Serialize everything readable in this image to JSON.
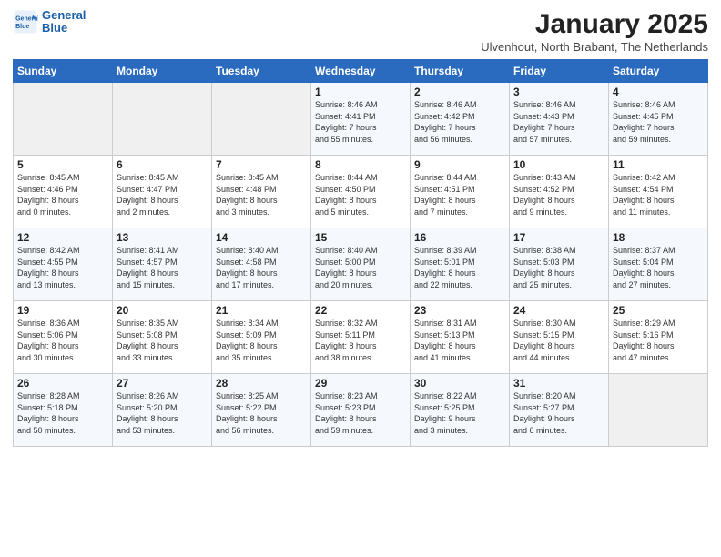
{
  "header": {
    "logo_line1": "General",
    "logo_line2": "Blue",
    "title": "January 2025",
    "subtitle": "Ulvenhout, North Brabant, The Netherlands"
  },
  "weekdays": [
    "Sunday",
    "Monday",
    "Tuesday",
    "Wednesday",
    "Thursday",
    "Friday",
    "Saturday"
  ],
  "weeks": [
    [
      {
        "day": "",
        "info": ""
      },
      {
        "day": "",
        "info": ""
      },
      {
        "day": "",
        "info": ""
      },
      {
        "day": "1",
        "info": "Sunrise: 8:46 AM\nSunset: 4:41 PM\nDaylight: 7 hours\nand 55 minutes."
      },
      {
        "day": "2",
        "info": "Sunrise: 8:46 AM\nSunset: 4:42 PM\nDaylight: 7 hours\nand 56 minutes."
      },
      {
        "day": "3",
        "info": "Sunrise: 8:46 AM\nSunset: 4:43 PM\nDaylight: 7 hours\nand 57 minutes."
      },
      {
        "day": "4",
        "info": "Sunrise: 8:46 AM\nSunset: 4:45 PM\nDaylight: 7 hours\nand 59 minutes."
      }
    ],
    [
      {
        "day": "5",
        "info": "Sunrise: 8:45 AM\nSunset: 4:46 PM\nDaylight: 8 hours\nand 0 minutes."
      },
      {
        "day": "6",
        "info": "Sunrise: 8:45 AM\nSunset: 4:47 PM\nDaylight: 8 hours\nand 2 minutes."
      },
      {
        "day": "7",
        "info": "Sunrise: 8:45 AM\nSunset: 4:48 PM\nDaylight: 8 hours\nand 3 minutes."
      },
      {
        "day": "8",
        "info": "Sunrise: 8:44 AM\nSunset: 4:50 PM\nDaylight: 8 hours\nand 5 minutes."
      },
      {
        "day": "9",
        "info": "Sunrise: 8:44 AM\nSunset: 4:51 PM\nDaylight: 8 hours\nand 7 minutes."
      },
      {
        "day": "10",
        "info": "Sunrise: 8:43 AM\nSunset: 4:52 PM\nDaylight: 8 hours\nand 9 minutes."
      },
      {
        "day": "11",
        "info": "Sunrise: 8:42 AM\nSunset: 4:54 PM\nDaylight: 8 hours\nand 11 minutes."
      }
    ],
    [
      {
        "day": "12",
        "info": "Sunrise: 8:42 AM\nSunset: 4:55 PM\nDaylight: 8 hours\nand 13 minutes."
      },
      {
        "day": "13",
        "info": "Sunrise: 8:41 AM\nSunset: 4:57 PM\nDaylight: 8 hours\nand 15 minutes."
      },
      {
        "day": "14",
        "info": "Sunrise: 8:40 AM\nSunset: 4:58 PM\nDaylight: 8 hours\nand 17 minutes."
      },
      {
        "day": "15",
        "info": "Sunrise: 8:40 AM\nSunset: 5:00 PM\nDaylight: 8 hours\nand 20 minutes."
      },
      {
        "day": "16",
        "info": "Sunrise: 8:39 AM\nSunset: 5:01 PM\nDaylight: 8 hours\nand 22 minutes."
      },
      {
        "day": "17",
        "info": "Sunrise: 8:38 AM\nSunset: 5:03 PM\nDaylight: 8 hours\nand 25 minutes."
      },
      {
        "day": "18",
        "info": "Sunrise: 8:37 AM\nSunset: 5:04 PM\nDaylight: 8 hours\nand 27 minutes."
      }
    ],
    [
      {
        "day": "19",
        "info": "Sunrise: 8:36 AM\nSunset: 5:06 PM\nDaylight: 8 hours\nand 30 minutes."
      },
      {
        "day": "20",
        "info": "Sunrise: 8:35 AM\nSunset: 5:08 PM\nDaylight: 8 hours\nand 33 minutes."
      },
      {
        "day": "21",
        "info": "Sunrise: 8:34 AM\nSunset: 5:09 PM\nDaylight: 8 hours\nand 35 minutes."
      },
      {
        "day": "22",
        "info": "Sunrise: 8:32 AM\nSunset: 5:11 PM\nDaylight: 8 hours\nand 38 minutes."
      },
      {
        "day": "23",
        "info": "Sunrise: 8:31 AM\nSunset: 5:13 PM\nDaylight: 8 hours\nand 41 minutes."
      },
      {
        "day": "24",
        "info": "Sunrise: 8:30 AM\nSunset: 5:15 PM\nDaylight: 8 hours\nand 44 minutes."
      },
      {
        "day": "25",
        "info": "Sunrise: 8:29 AM\nSunset: 5:16 PM\nDaylight: 8 hours\nand 47 minutes."
      }
    ],
    [
      {
        "day": "26",
        "info": "Sunrise: 8:28 AM\nSunset: 5:18 PM\nDaylight: 8 hours\nand 50 minutes."
      },
      {
        "day": "27",
        "info": "Sunrise: 8:26 AM\nSunset: 5:20 PM\nDaylight: 8 hours\nand 53 minutes."
      },
      {
        "day": "28",
        "info": "Sunrise: 8:25 AM\nSunset: 5:22 PM\nDaylight: 8 hours\nand 56 minutes."
      },
      {
        "day": "29",
        "info": "Sunrise: 8:23 AM\nSunset: 5:23 PM\nDaylight: 8 hours\nand 59 minutes."
      },
      {
        "day": "30",
        "info": "Sunrise: 8:22 AM\nSunset: 5:25 PM\nDaylight: 9 hours\nand 3 minutes."
      },
      {
        "day": "31",
        "info": "Sunrise: 8:20 AM\nSunset: 5:27 PM\nDaylight: 9 hours\nand 6 minutes."
      },
      {
        "day": "",
        "info": ""
      }
    ]
  ]
}
